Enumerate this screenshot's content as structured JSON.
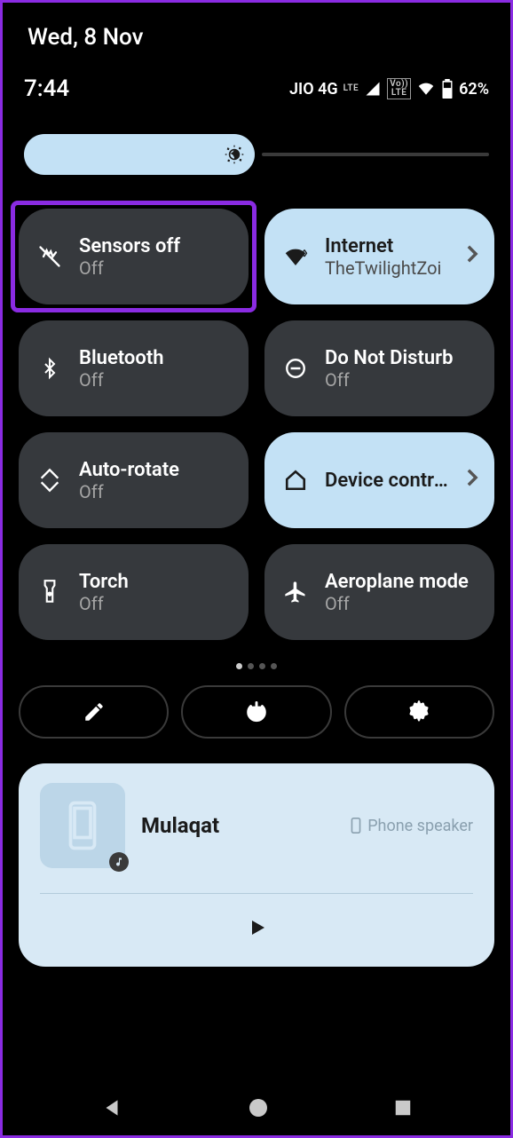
{
  "date": "Wed, 8 Nov",
  "time": "7:44",
  "status": {
    "carrier": "JIO 4G",
    "net_badge": "LTE",
    "volte_badge": "Vo))\nLTE",
    "battery_pct": "62%"
  },
  "brightness": {
    "level_pct": 48
  },
  "tiles": [
    {
      "title": "Sensors off",
      "sub": "Off",
      "active": false,
      "highlight": true,
      "icon": "sensors-off-icon"
    },
    {
      "title": "Internet",
      "sub": "TheTwilightZoi",
      "active": true,
      "chevron": true,
      "icon": "wifi-icon"
    },
    {
      "title": "Bluetooth",
      "sub": "Off",
      "active": false,
      "icon": "bluetooth-icon"
    },
    {
      "title": "Do Not Disturb",
      "sub": "Off",
      "active": false,
      "icon": "dnd-icon"
    },
    {
      "title": "Auto-rotate",
      "sub": "Off",
      "active": false,
      "icon": "auto-rotate-icon"
    },
    {
      "title": "Device controls",
      "sub": "",
      "active": true,
      "chevron": true,
      "icon": "home-icon"
    },
    {
      "title": "Torch",
      "sub": "Off",
      "active": false,
      "icon": "torch-icon"
    },
    {
      "title": "Aeroplane mode",
      "sub": "Off",
      "active": false,
      "icon": "airplane-icon"
    }
  ],
  "page_indicator": {
    "count": 4,
    "active_index": 0
  },
  "controls": {
    "edit": "edit-icon",
    "power": "power-icon",
    "settings": "gear-icon"
  },
  "media": {
    "title": "Mulaqat",
    "output": "Phone speaker"
  }
}
